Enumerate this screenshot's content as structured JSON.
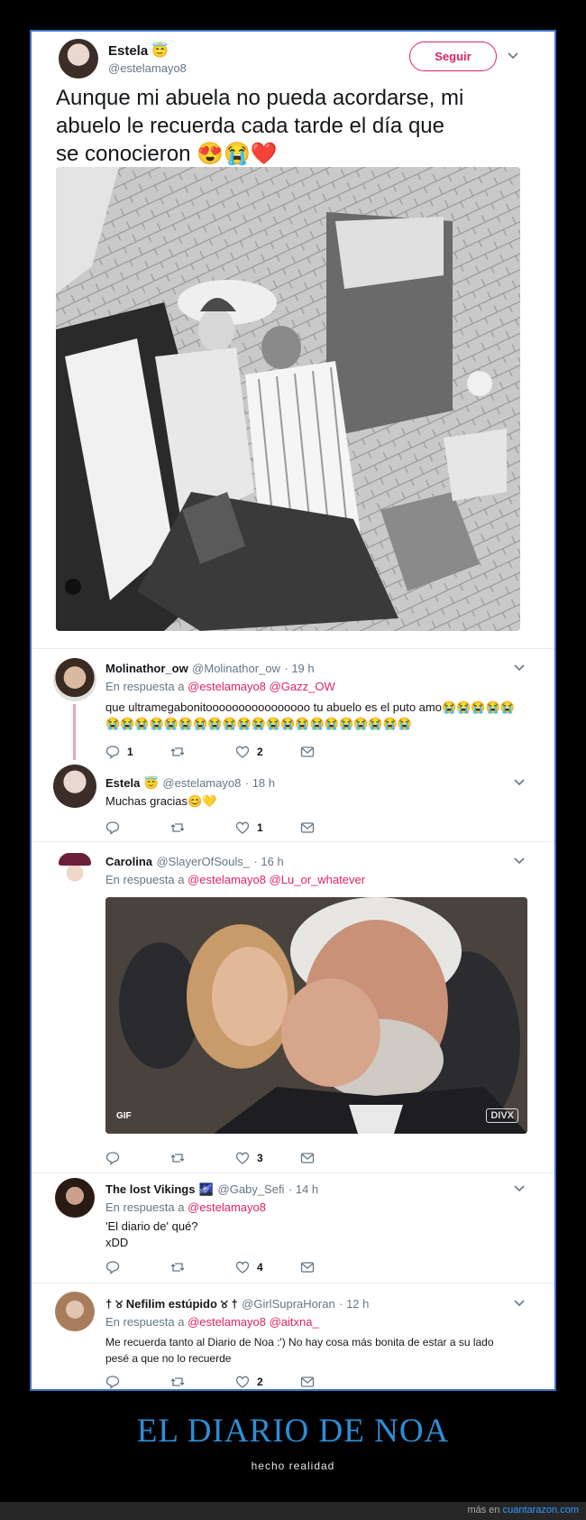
{
  "main_tweet": {
    "name": "Estela",
    "name_emoji": "😇",
    "handle": "@estelamayo8",
    "follow_label": "Seguir",
    "text": "Aunque mi abuela no pueda acordarse, mi abuelo le recuerda cada tarde el día que se conocieron 😍😭❤️"
  },
  "replies": [
    {
      "name": "Molinathor_ow",
      "handle": "@Molinathor_ow",
      "time": "· 19 h",
      "reply_prefix": "En respuesta a",
      "reply_to": "@estelamayo8 @Gazz_OW",
      "text": "que ultramegabonitoooooooooooooooo tu abuelo es el puto amo😭😭😭😭😭 😭😭😭😭😭😭😭😭😭😭😭😭😭😭😭😭😭😭😭😭😭",
      "replies_count": "1",
      "likes_count": "2"
    },
    {
      "name": "Estela",
      "name_emoji": "😇",
      "handle": "@estelamayo8",
      "time": "· 18 h",
      "text": "Muchas gracias😊💛",
      "likes_count": "1"
    },
    {
      "name": "Carolina",
      "handle": "@SlayerOfSouls_",
      "time": "· 16 h",
      "reply_prefix": "En respuesta a",
      "reply_to": "@estelamayo8 @Lu_or_whatever",
      "gif_badge": "GIF",
      "divx_badge": "DIVX",
      "likes_count": "3"
    },
    {
      "name": "The lost Vikings",
      "name_emoji": "🌌",
      "handle": "@Gaby_Sefi",
      "time": "· 14 h",
      "reply_prefix": "En respuesta a",
      "reply_to": "@estelamayo8",
      "text_line1": "'El diario de' qué?",
      "text_line2": "xDD",
      "likes_count": "4"
    },
    {
      "name": "† ୪ Nefilim estúpido ୪ †",
      "handle": "@GirlSupraHoran",
      "time": "· 12 h",
      "reply_prefix": "En respuesta a",
      "reply_to": "@estelamayo8 @aitxna_",
      "text_line1": "Me recuerda tanto al Diario de Noa :') No hay cosa más bonita de estar a su lado",
      "text_line2": "pesé a que no lo recuerde",
      "likes_count": "2"
    }
  ],
  "footer": {
    "title": "EL DIARIO DE NOA",
    "subtitle": "hecho realidad",
    "more_prefix": "más en",
    "more_link": "cuantarazon.com"
  }
}
